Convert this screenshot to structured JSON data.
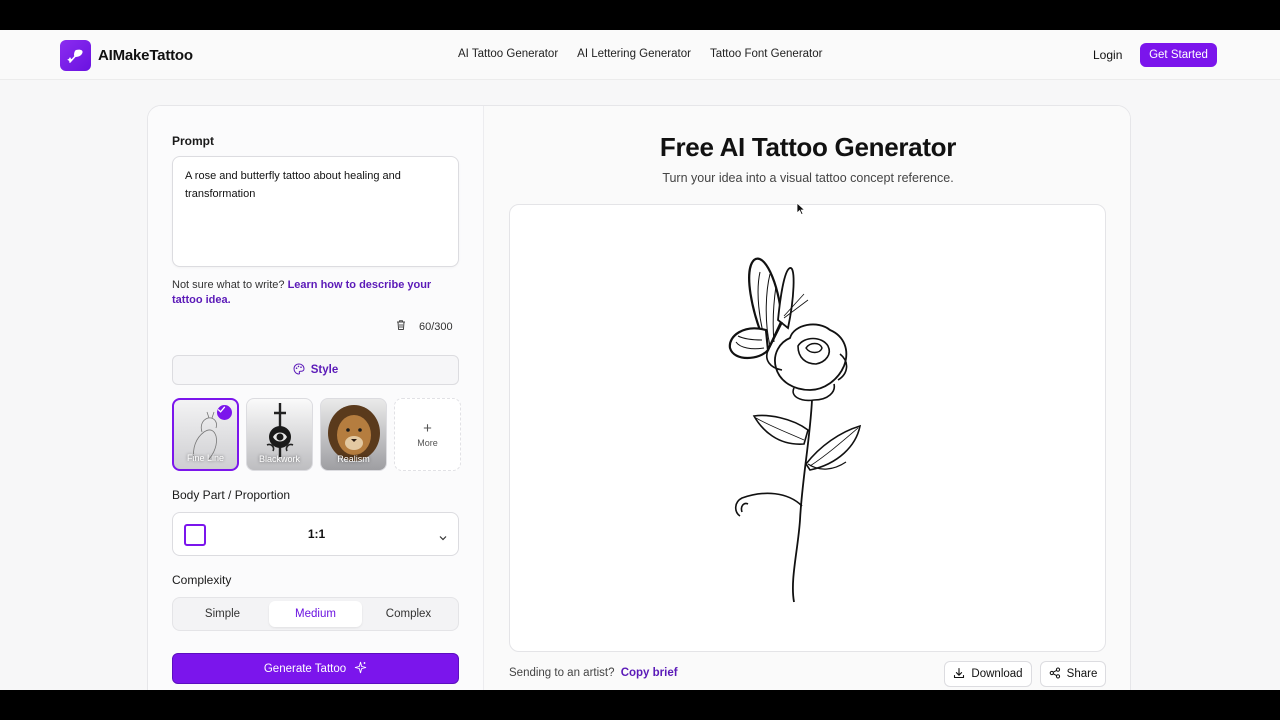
{
  "app": {
    "name": "AIMakeTattoo"
  },
  "header": {
    "nav": [
      "AI Tattoo Generator",
      "AI Lettering Generator",
      "Tattoo Font Generator"
    ],
    "login_label": "Login",
    "cta_label": "Get Started"
  },
  "left": {
    "prompt_label": "Prompt",
    "prompt_value": "A rose and butterfly tattoo about healing and transformation",
    "hint_text": "Not sure what to write?",
    "hint_link": "Learn how to describe your tattoo idea.",
    "char_count": "60/300",
    "style_label": "Style",
    "styles": [
      {
        "label": "Fine Line",
        "selected": true
      },
      {
        "label": "Blackwork",
        "selected": false
      },
      {
        "label": "Realism",
        "selected": false
      }
    ],
    "more_label": "More",
    "body_part_label": "Body Part / Proportion",
    "ratio_value": "1:1",
    "complexity_label": "Complexity",
    "complexity_options": [
      "Simple",
      "Medium",
      "Complex"
    ],
    "complexity_selected": "Medium",
    "generate_label": "Generate Tattoo"
  },
  "right": {
    "title": "Free AI Tattoo Generator",
    "subtitle": "Turn your idea into a visual tattoo concept reference.",
    "send_text": "Sending to an artist?",
    "copy_brief": "Copy brief",
    "download_label": "Download",
    "share_label": "Share"
  },
  "colors": {
    "accent": "#7b15ec",
    "accent_text": "#5b1ab8",
    "background": "#f7f7f8"
  },
  "icons": [
    "logo-quill-icon",
    "trash-icon",
    "palette-icon",
    "check-icon",
    "plus-icon",
    "chevron-down-icon",
    "sparkle-icon",
    "download-icon",
    "share-icon",
    "cursor-icon"
  ]
}
